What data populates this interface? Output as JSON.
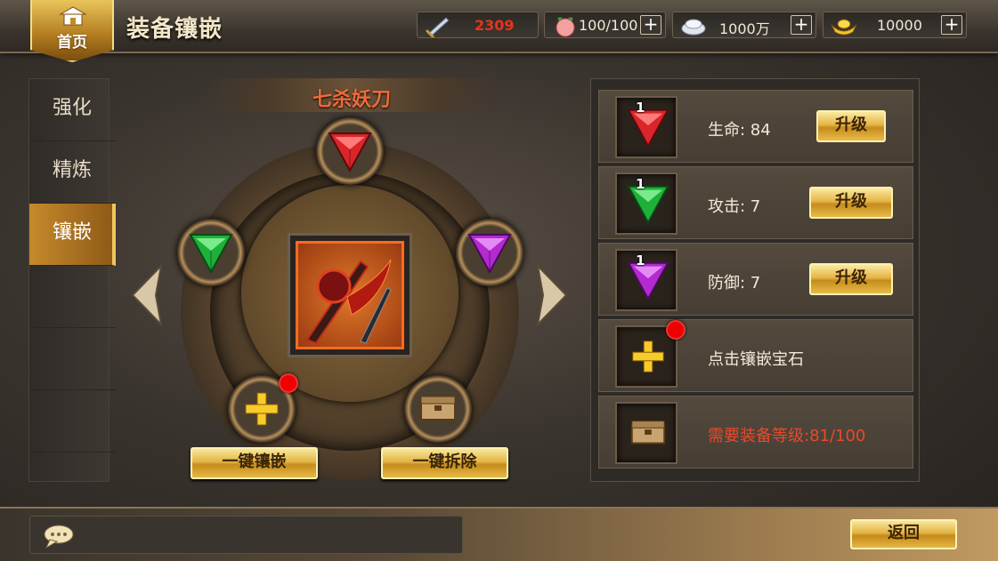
{
  "header": {
    "home_label": "首页",
    "title": "装备镶嵌",
    "resources": [
      {
        "icon": "sword-power-icon",
        "value": "2309",
        "has_plus": false,
        "value_color": "#e8341a"
      },
      {
        "icon": "peach-stamina-icon",
        "value": "100/100",
        "has_plus": true
      },
      {
        "icon": "silver-coin-icon",
        "value": "1000万",
        "has_plus": true
      },
      {
        "icon": "gold-ingot-icon",
        "value": "10000",
        "has_plus": true
      }
    ],
    "plus_label": "+"
  },
  "tabs": [
    {
      "label": "强化",
      "active": false
    },
    {
      "label": "精炼",
      "active": false
    },
    {
      "label": "镶嵌",
      "active": true
    }
  ],
  "equipment": {
    "name": "七杀妖刀",
    "name_color": "#f06a3a",
    "sockets": {
      "top": "red-gem",
      "left": "green-gem",
      "right": "purple-gem",
      "bottom_left": "add-gem",
      "bottom_right": "locked-chest"
    }
  },
  "actions": {
    "embed_all": "一键镶嵌",
    "remove_all": "一键拆除"
  },
  "gem_slots": [
    {
      "gem": "red-gem",
      "level": "1",
      "stat": "生命: 84",
      "button": "升级"
    },
    {
      "gem": "green-gem",
      "level": "1",
      "stat": "攻击: 7",
      "button": "升级"
    },
    {
      "gem": "purple-gem",
      "level": "1",
      "stat": "防御: 7",
      "button": "升级"
    },
    {
      "gem": "add-gem",
      "level": "",
      "stat": "点击镶嵌宝石",
      "button": ""
    },
    {
      "gem": "locked-chest",
      "level": "",
      "stat": "需要装备等级:81/100",
      "button": ""
    }
  ],
  "footer": {
    "back_label": "返回"
  },
  "colors": {
    "gold": "#e2b445",
    "warn": "#e84a2a",
    "red_dot": "#e00000"
  }
}
